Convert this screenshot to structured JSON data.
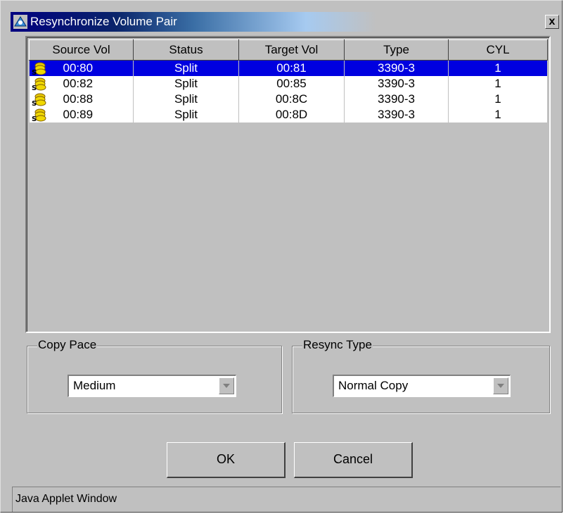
{
  "window": {
    "title": "Resynchronize Volume Pair",
    "close_label": "x"
  },
  "table": {
    "columns": [
      "Source Vol",
      "Status",
      "Target Vol",
      "Type",
      "CYL"
    ],
    "rows": [
      {
        "source": "00:80",
        "status": "Split",
        "target": "00:81",
        "type": "3390-3",
        "cyl": "1",
        "selected": true
      },
      {
        "source": "00:82",
        "status": "Split",
        "target": "00:85",
        "type": "3390-3",
        "cyl": "1",
        "selected": false
      },
      {
        "source": "00:88",
        "status": "Split",
        "target": "00:8C",
        "type": "3390-3",
        "cyl": "1",
        "selected": false
      },
      {
        "source": "00:89",
        "status": "Split",
        "target": "00:8D",
        "type": "3390-3",
        "cyl": "1",
        "selected": false
      }
    ]
  },
  "copy_pace": {
    "label": "Copy Pace",
    "value": "Medium"
  },
  "resync_type": {
    "label": "Resync Type",
    "value": "Normal Copy"
  },
  "buttons": {
    "ok": "OK",
    "cancel": "Cancel"
  },
  "status_bar": {
    "text": "Java Applet Window"
  },
  "colors": {
    "selection": "#0000e0",
    "title_bar": "#000080",
    "face": "#c0c0c0"
  }
}
